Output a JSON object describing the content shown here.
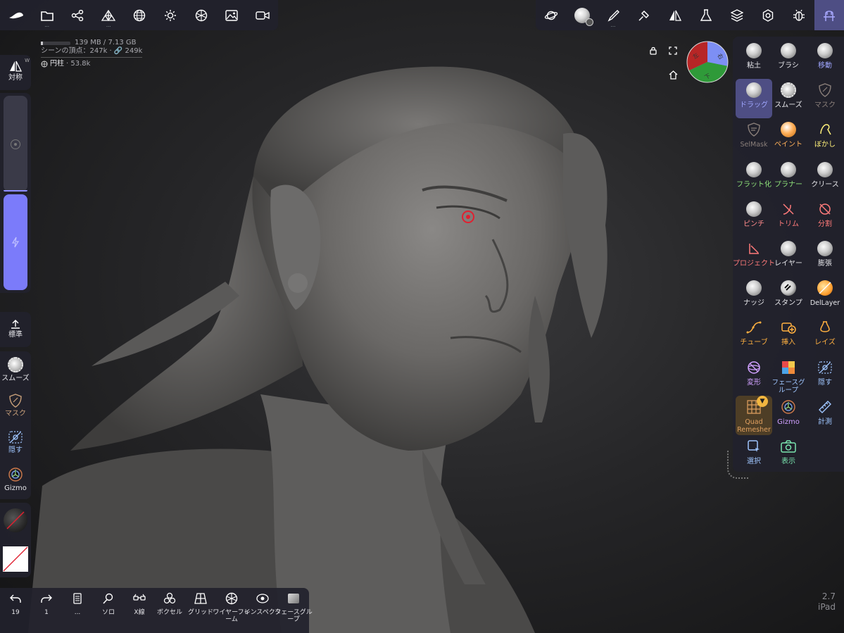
{
  "top_left_toolbar": [
    {
      "name": "nomad-logo-icon"
    },
    {
      "name": "folder-icon",
      "more": "..."
    },
    {
      "name": "scene-graph-icon"
    },
    {
      "name": "topology-icon",
      "more": "..."
    },
    {
      "name": "wireframe-sphere-icon"
    },
    {
      "name": "light-icon"
    },
    {
      "name": "material-icon"
    },
    {
      "name": "image-icon"
    },
    {
      "name": "video-icon"
    }
  ],
  "top_right_toolbar": [
    {
      "name": "planet-icon"
    },
    {
      "name": "material-sphere-icon"
    },
    {
      "name": "brush-icon",
      "more": "..."
    },
    {
      "name": "hammer-icon"
    },
    {
      "name": "symmetry-icon"
    },
    {
      "name": "flask-icon"
    },
    {
      "name": "layers-icon"
    },
    {
      "name": "settings-icon"
    },
    {
      "name": "bug-icon"
    },
    {
      "name": "tools-menu-icon"
    }
  ],
  "stats": {
    "memory": "139 MB / 7.13 GB",
    "vertices": "シーンの頂点：247k · 🔗 249k",
    "object": "円柱",
    "object_count": "· 53.8k"
  },
  "left_panel": {
    "symmetry_label": "対称",
    "symmetry_badge": "W",
    "standard_label": "標準",
    "smooth_label": "スムーズ",
    "mask_label": "マスク",
    "hide_label": "隠す",
    "gizmo_label": "Gizmo",
    "radius_level": 0.0,
    "intensity_level": 1.0
  },
  "tools": [
    {
      "label": "粘土",
      "color": "#e6e6ea",
      "icon": "sphere-icon"
    },
    {
      "label": "ブラシ",
      "color": "#e6e6ea",
      "icon": "sphere-icon"
    },
    {
      "label": "移動",
      "color": "#9fa6ff",
      "icon": "sphere-icon"
    },
    {
      "label": "ドラッグ",
      "color": "#9fa6ff",
      "icon": "sphere-icon",
      "active": true
    },
    {
      "label": "スムーズ",
      "color": "#e6e6ea",
      "icon": "smooth-icon"
    },
    {
      "label": "マスク",
      "color": "#8a7f7a",
      "icon": "mask-icon"
    },
    {
      "label": "SelMask",
      "color": "#8a7f7a",
      "icon": "selmask-icon"
    },
    {
      "label": "ペイント",
      "color": "#ffb05a",
      "icon": "paint-sphere-icon"
    },
    {
      "label": "ぼかし",
      "color": "#fff17a",
      "icon": "smudge-icon"
    },
    {
      "label": "フラット化",
      "color": "#8fe37a",
      "icon": "sphere-icon"
    },
    {
      "label": "プラナー",
      "color": "#8fe37a",
      "icon": "sphere-icon"
    },
    {
      "label": "クリース",
      "color": "#e6e6ea",
      "icon": "sphere-icon"
    },
    {
      "label": "ピンチ",
      "color": "#ff8a8a",
      "icon": "sphere-icon"
    },
    {
      "label": "トリム",
      "color": "#ff7a7a",
      "icon": "trim-icon"
    },
    {
      "label": "分割",
      "color": "#ff7a7a",
      "icon": "split-icon"
    },
    {
      "label": "プロジェクト",
      "color": "#ff7a7a",
      "icon": "project-icon"
    },
    {
      "label": "レイヤー",
      "color": "#e6e6ea",
      "icon": "sphere-icon"
    },
    {
      "label": "膨張",
      "color": "#e6e6ea",
      "icon": "sphere-icon"
    },
    {
      "label": "ナッジ",
      "color": "#e6e6ea",
      "icon": "sphere-icon"
    },
    {
      "label": "スタンプ",
      "color": "#e6e6ea",
      "icon": "stamp-icon"
    },
    {
      "label": "DelLayer",
      "color": "#e6e6ea",
      "icon": "dellayer-icon"
    },
    {
      "label": "チューブ",
      "color": "#ffb040",
      "icon": "tube-icon"
    },
    {
      "label": "挿入",
      "color": "#ffb040",
      "icon": "insert-icon"
    },
    {
      "label": "レイズ",
      "color": "#ffb040",
      "icon": "lathe-icon"
    },
    {
      "label": "変形",
      "color": "#d0a0ff",
      "icon": "transform-icon"
    },
    {
      "label": "フェースグループ",
      "color": "#9fc6ff",
      "icon": "facegroup-icon"
    },
    {
      "label": "隠す",
      "color": "#9fc6ff",
      "icon": "hide-icon"
    },
    {
      "label": "Quad Remesher",
      "color": "#e0a060",
      "icon": "quad-remesher-icon",
      "highlight": true
    },
    {
      "label": "Gizmo",
      "color": "#d0a0ff",
      "icon": "gizmo-icon"
    },
    {
      "label": "計測",
      "color": "#9fc6ff",
      "icon": "ruler-icon"
    },
    {
      "label": "選択",
      "color": "#9fc6ff",
      "icon": "select-icon"
    },
    {
      "label": "表示",
      "color": "#7ae6b0",
      "icon": "camera-icon"
    }
  ],
  "bottom_toolbar": [
    {
      "label": "19",
      "icon": "undo-icon"
    },
    {
      "label": "1",
      "icon": "redo-icon"
    },
    {
      "label": "...",
      "icon": "history-icon"
    },
    {
      "label": "ソロ",
      "icon": "solo-icon"
    },
    {
      "label": "X線",
      "icon": "xray-icon"
    },
    {
      "label": "ボクセル",
      "icon": "voxel-icon"
    },
    {
      "label": "グリッド",
      "icon": "grid-icon"
    },
    {
      "label": "ワイヤーフレーム",
      "icon": "wireframe-icon"
    },
    {
      "label": "インスペクタ",
      "icon": "inspector-icon"
    },
    {
      "label": "フェースグループ",
      "icon": "facegroup-bottom-icon"
    }
  ],
  "orientation_cube": {
    "labels": [
      "左",
      "右",
      "下"
    ]
  },
  "version": {
    "number": "2.7",
    "device": "iPad"
  },
  "colors": {
    "accent": "#7b7bfa",
    "active": "#4e4e84",
    "cursor": "#e12030"
  }
}
